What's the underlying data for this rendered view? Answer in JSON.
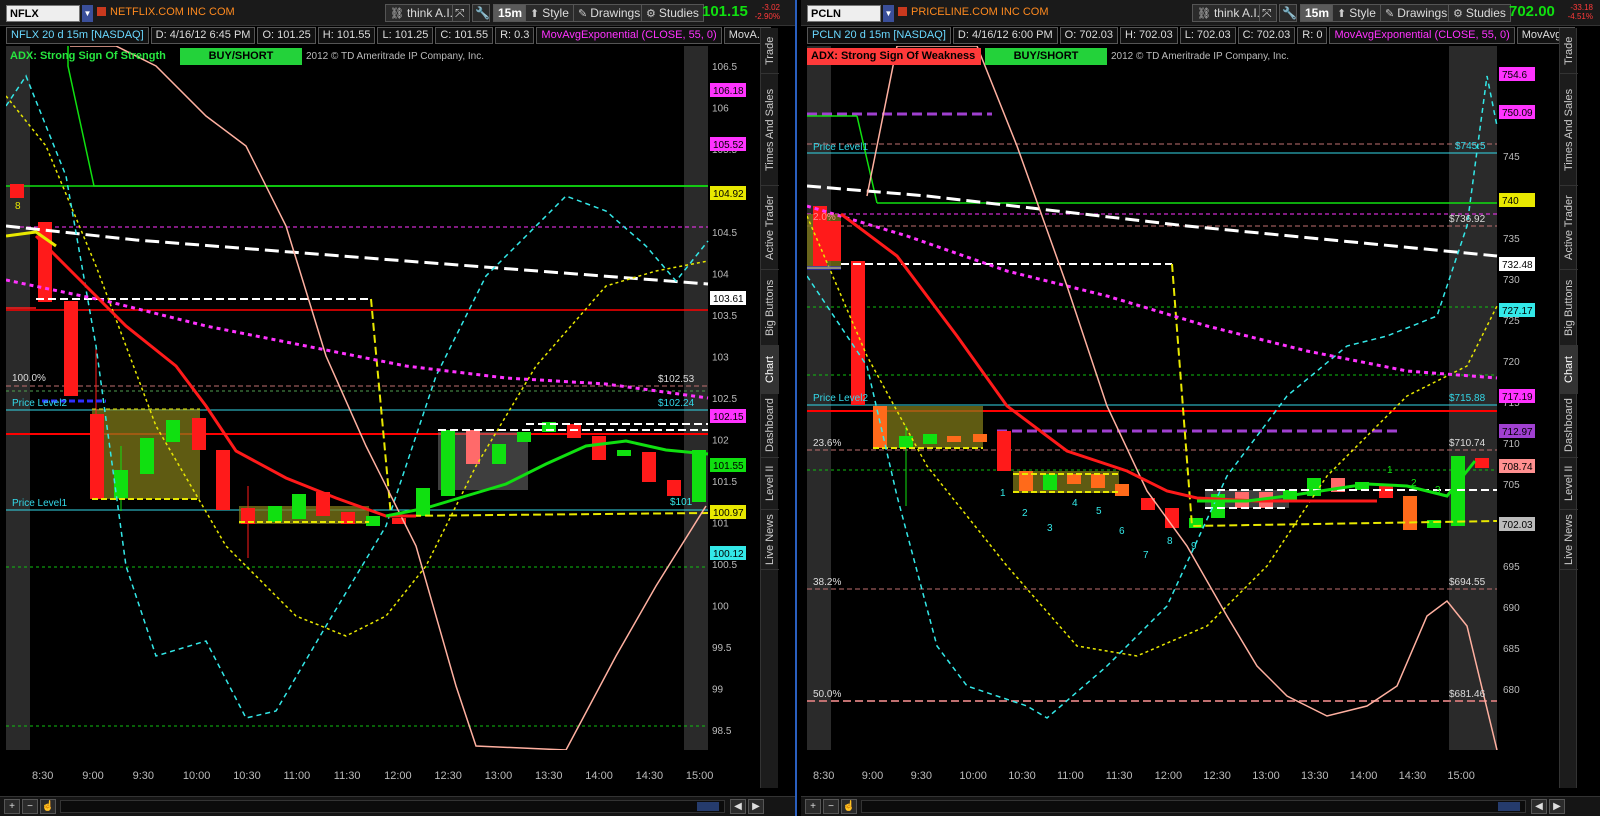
{
  "left": {
    "symbol": "NFLX",
    "company": "NETFLIX.COM INC COM",
    "think_label": "think A.I.",
    "interval": "15m",
    "style_label": "Style",
    "drawings_label": "Drawings",
    "studies_label": "Studies",
    "last_price": "101.15",
    "change": "-3.02",
    "change_pct": "-2.90%",
    "info": [
      "NFLX 20 d 15m [NASDAQ]",
      "D: 4/16/12 6:45 PM",
      "O: 101.25",
      "H: 101.55",
      "L: 101.25",
      "C: 101.55",
      "R: 0.3",
      "MovAvgExponential (CLOSE, 55, 0)",
      "MovA..."
    ],
    "adx_label": "ADX:  Strong Sign Of Strength",
    "adx_color": "#27e63f",
    "signal": "BUY/SHORT",
    "copyright": "2012 © TD Ameritrade IP Company, Inc.",
    "x_ticks": [
      "8:30",
      "9:00",
      "9:30",
      "10:00",
      "10:30",
      "11:00",
      "11:30",
      "12:00",
      "12:30",
      "13:00",
      "13:30",
      "14:00",
      "14:30",
      "15:00"
    ],
    "y_ticks": [
      "106.5",
      "106",
      "105.5",
      "105",
      "104.5",
      "104",
      "103.5",
      "103",
      "102.5",
      "102",
      "101.5",
      "101",
      "100.5",
      "100",
      "99.5",
      "99",
      "98.5"
    ],
    "labels": {
      "price_level_1": "Price Level1",
      "price_level_2": "Price Level2",
      "fib_100": "100.0%",
      "p_10253": "$102.53",
      "p_10224": "$102.24",
      "p_101": "$101",
      "eight": "8"
    },
    "badges": [
      {
        "text": "106.18",
        "color": "#ff33ff"
      },
      {
        "text": "105.52",
        "color": "#ff33ff"
      },
      {
        "text": "104.92",
        "color": "#e8e800"
      },
      {
        "text": "103.61",
        "color": "#ffffff"
      },
      {
        "text": "102.15",
        "color": "#ff33ff"
      },
      {
        "text": "101.55",
        "color": "#10e010"
      },
      {
        "text": "100.97",
        "color": "#e8e800"
      },
      {
        "text": "100.12",
        "color": "#33e8e8"
      }
    ]
  },
  "right": {
    "symbol": "PCLN",
    "company": "PRICELINE.COM INC COM",
    "think_label": "think A.I.",
    "interval": "15m",
    "style_label": "Style",
    "drawings_label": "Drawings",
    "studies_label": "Studies",
    "last_price": "702.00",
    "change": "-33.18",
    "change_pct": "-4.51%",
    "info": [
      "PCLN 20 d 15m [NASDAQ]",
      "D: 4/16/12 6:00 PM",
      "O: 702.03",
      "H: 702.03",
      "L: 702.03",
      "C: 702.03",
      "R: 0",
      "MovAvgExponential (CLOSE, 55, 0)",
      "MovAvg..."
    ],
    "adx_label": "ADX:  Strong Sign Of Weakness",
    "adx_color": "#ff3a3a",
    "signal": "BUY/SHORT",
    "copyright": "2012 © TD Ameritrade IP Company, Inc.",
    "x_ticks": [
      "8:30",
      "9:00",
      "9:30",
      "10:00",
      "10:30",
      "11:00",
      "11:30",
      "12:00",
      "12:30",
      "13:00",
      "13:30",
      "14:00",
      "14:30",
      "15:00"
    ],
    "y_ticks": [
      "755",
      "750",
      "745",
      "740",
      "735",
      "730",
      "725",
      "720",
      "715",
      "710",
      "705",
      "700",
      "695",
      "690",
      "685",
      "680"
    ],
    "labels": {
      "price_level_1": "Price Level1",
      "price_level_2": "Price Level2",
      "fib_236": "23.6%",
      "fib_382": "38.2%",
      "fib_50": "50.0%",
      "p_7455": "$745.5",
      "p_73692": "$736.92",
      "p_71588": "$715.88",
      "p_71074": "$710.74",
      "p_69455": "$694.55",
      "p_68146": "$681.46",
      "fib_pct_top": "2.0%",
      "c1": "1",
      "c2": "2",
      "c3": "3",
      "c4": "4",
      "c5": "5",
      "c6": "6",
      "c7": "7",
      "c8": "8",
      "c9": "9",
      "g1": "1",
      "g2": "2",
      "g3": "3"
    },
    "badges": [
      {
        "text": "754.6",
        "color": "#ff33ff"
      },
      {
        "text": "750.09",
        "color": "#ff33ff"
      },
      {
        "text": "740",
        "color": "#e8e800"
      },
      {
        "text": "732.48",
        "color": "#ffffff"
      },
      {
        "text": "727.17",
        "color": "#33e8e8"
      },
      {
        "text": "717.19",
        "color": "#ff33ff"
      },
      {
        "text": "712.97",
        "color": "#a040d0"
      },
      {
        "text": "708.74",
        "color": "#ff9090"
      },
      {
        "text": "702.03",
        "color": "#bbbbbb"
      }
    ]
  },
  "side_tabs": [
    "Trade",
    "Times And Sales",
    "Active Trader",
    "Big Buttons",
    "Chart",
    "Dashboard",
    "Level II",
    "Live News"
  ]
}
